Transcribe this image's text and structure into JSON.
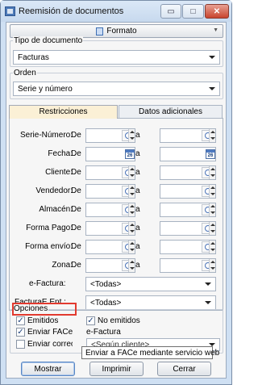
{
  "window": {
    "title": "Reemisión de documentos",
    "controls": {
      "minimize": "▭",
      "maximize": "□",
      "close": "✕"
    }
  },
  "formato": {
    "label": "Formato"
  },
  "tipo_documento": {
    "label": "Tipo de documento",
    "value": "Facturas"
  },
  "orden": {
    "label": "Orden",
    "value": "Serie y número"
  },
  "tabs": [
    {
      "label": "Restricciones",
      "active": true
    },
    {
      "label": "Datos adicionales",
      "active": false
    }
  ],
  "restricciones": {
    "de_label": "De",
    "a_label": "a",
    "rows": [
      {
        "label": "Serie-Número:",
        "type": "lookup"
      },
      {
        "label": "Fecha:",
        "type": "date"
      },
      {
        "label": "Cliente:",
        "type": "lookup"
      },
      {
        "label": "Vendedor:",
        "type": "lookup"
      },
      {
        "label": "Almacén:",
        "type": "lookup"
      },
      {
        "label": "Forma Pago:",
        "type": "lookup"
      },
      {
        "label": "Forma envío:",
        "type": "lookup"
      },
      {
        "label": "Zona:",
        "type": "lookup"
      }
    ],
    "calendar_day": "26",
    "efactura": {
      "label": "e-Factura:",
      "value": "<Todas>"
    },
    "facturae_ent": {
      "label": "FacturaE Ent.:",
      "value": "<Todas>"
    }
  },
  "opciones": {
    "label": "Opciones",
    "emitidos": {
      "label": "Emitidos",
      "checked": true
    },
    "no_emitidos": {
      "label": "No emitidos",
      "checked": true
    },
    "enviar_face": {
      "label": "Enviar FACe",
      "checked": true
    },
    "enviar_correo": {
      "label": "Enviar correo",
      "checked": false
    },
    "efactura_label": "e-Factura",
    "efactura_value": "<Según cliente>",
    "tooltip": "Enviar a FACe mediante servicio web"
  },
  "buttons": {
    "mostrar": "Mostrar",
    "imprimir": "Imprimir",
    "cerrar": "Cerrar"
  },
  "colors": {
    "window_frame": "#cfe0f3",
    "active_tab": "#fbf0d6",
    "highlight": "#e23a2f"
  }
}
